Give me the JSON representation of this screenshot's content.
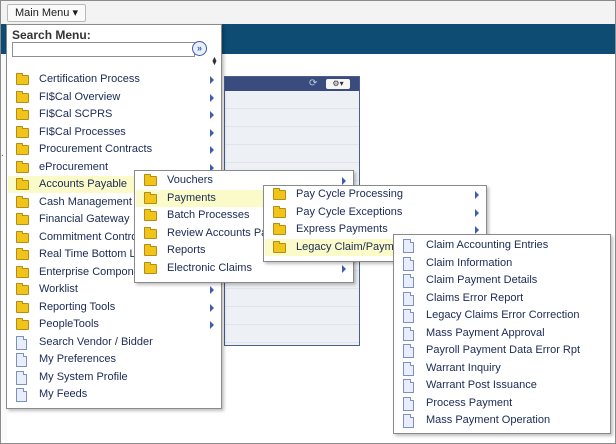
{
  "top_bar": {
    "main_menu_label": "Main Menu ▾"
  },
  "menu": {
    "search_title": "Search Menu:",
    "search_value": "",
    "items": [
      {
        "label": "Certification Process",
        "icon": "folder-icon",
        "submenu": true
      },
      {
        "label": "FI$Cal Overview",
        "icon": "folder-icon",
        "submenu": true
      },
      {
        "label": "FI$Cal SCPRS",
        "icon": "folder-icon",
        "submenu": true
      },
      {
        "label": "FI$Cal Processes",
        "icon": "folder-icon",
        "submenu": true
      },
      {
        "label": "Procurement Contracts",
        "icon": "folder-icon",
        "submenu": true
      },
      {
        "label": "eProcurement",
        "icon": "folder-icon",
        "submenu": true
      },
      {
        "label": "Accounts Payable",
        "icon": "folder-icon",
        "submenu": true,
        "highlighted": true
      },
      {
        "label": "Cash Management",
        "icon": "folder-icon",
        "submenu": true
      },
      {
        "label": "Financial Gateway",
        "icon": "folder-icon",
        "submenu": true
      },
      {
        "label": "Commitment Control",
        "icon": "folder-icon",
        "submenu": true
      },
      {
        "label": "Real Time Bottom Line",
        "icon": "folder-icon",
        "submenu": true
      },
      {
        "label": "Enterprise Components",
        "icon": "folder-icon",
        "submenu": true
      },
      {
        "label": "Worklist",
        "icon": "folder-icon",
        "submenu": true
      },
      {
        "label": "Reporting Tools",
        "icon": "folder-icon",
        "submenu": true
      },
      {
        "label": "PeopleTools",
        "icon": "folder-icon",
        "submenu": true
      },
      {
        "label": "Search Vendor / Bidder",
        "icon": "document-icon",
        "submenu": false
      },
      {
        "label": "My Preferences",
        "icon": "document-icon",
        "submenu": false
      },
      {
        "label": "My System Profile",
        "icon": "document-icon",
        "submenu": false
      },
      {
        "label": "My Feeds",
        "icon": "document-icon",
        "submenu": false
      }
    ]
  },
  "accounts_payable_menu": {
    "items": [
      {
        "label": "Vouchers",
        "submenu": true
      },
      {
        "label": "Payments",
        "submenu": true,
        "highlighted": true
      },
      {
        "label": "Batch Processes",
        "submenu": true
      },
      {
        "label": "Review Accounts Payab",
        "submenu": true
      },
      {
        "label": "Reports",
        "submenu": true
      },
      {
        "label": "Electronic Claims",
        "submenu": true
      }
    ]
  },
  "payments_menu": {
    "items": [
      {
        "label": "Pay Cycle Processing",
        "submenu": true
      },
      {
        "label": "Pay Cycle Exceptions",
        "submenu": true
      },
      {
        "label": "Express Payments",
        "submenu": true
      },
      {
        "label": "Legacy Claim/Payment",
        "submenu": true,
        "highlighted": true
      }
    ]
  },
  "legacy_menu": {
    "items": [
      {
        "label": "Claim Accounting Entries"
      },
      {
        "label": "Claim Information"
      },
      {
        "label": "Claim Payment Details"
      },
      {
        "label": "Claims Error Report"
      },
      {
        "label": "Legacy Claims Error Correction"
      },
      {
        "label": "Mass Payment Approval"
      },
      {
        "label": "Payroll Payment Data Error Rpt"
      },
      {
        "label": "Warrant Inquiry"
      },
      {
        "label": "Warrant Post Issuance"
      },
      {
        "label": "Process Payment"
      },
      {
        "label": "Mass Payment Operation"
      }
    ]
  },
  "colors": {
    "banner": "#0e4c73",
    "highlight": "#fbfbc9",
    "menu_text": "#1a2a55",
    "folder": "#f0c419"
  }
}
